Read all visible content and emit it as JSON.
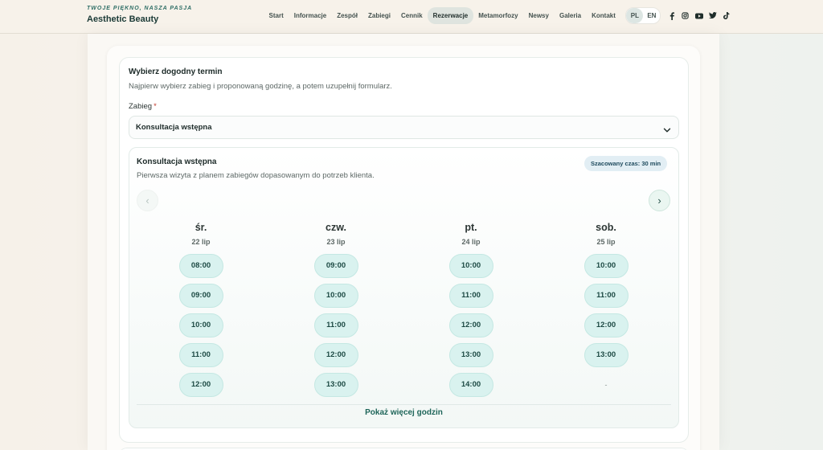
{
  "header": {
    "tagline": "TWOJE PIĘKNO, NASZA PASJA",
    "brand": "Aesthetic Beauty",
    "nav": [
      {
        "label": "Start",
        "active": false
      },
      {
        "label": "Informacje",
        "active": false
      },
      {
        "label": "Zespół",
        "active": false
      },
      {
        "label": "Zabiegi",
        "active": false
      },
      {
        "label": "Cennik",
        "active": false
      },
      {
        "label": "Rezerwacje",
        "active": true
      },
      {
        "label": "Metamorfozy",
        "active": false
      },
      {
        "label": "Newsy",
        "active": false
      },
      {
        "label": "Galeria",
        "active": false
      },
      {
        "label": "Kontakt",
        "active": false
      }
    ],
    "languages": [
      {
        "label": "PL",
        "active": true
      },
      {
        "label": "EN",
        "active": false
      }
    ],
    "social_icons": [
      "facebook-icon",
      "instagram-icon",
      "youtube-icon",
      "twitter-icon",
      "tiktok-icon"
    ]
  },
  "booking": {
    "title": "Wybierz dogodny termin",
    "subtitle": "Najpierw wybierz zabieg i proponowaną godzinę, a potem uzupełnij formularz.",
    "service_label": "Zabieg",
    "required_mark": "*",
    "selected_service": "Konsultacja wstępna",
    "service_name": "Konsultacja wstępna",
    "service_description": "Pierwsza wizyta z planem zabiegów dopasowanym do potrzeb klienta.",
    "duration_badge": "Szacowany czas: 30 min",
    "prev_label": "‹",
    "next_label": "›",
    "days": [
      {
        "name": "śr.",
        "date": "22 lip",
        "slots": [
          "08:00",
          "09:00",
          "10:00",
          "11:00",
          "12:00"
        ]
      },
      {
        "name": "czw.",
        "date": "23 lip",
        "slots": [
          "09:00",
          "10:00",
          "11:00",
          "12:00",
          "13:00"
        ]
      },
      {
        "name": "pt.",
        "date": "24 lip",
        "slots": [
          "10:00",
          "11:00",
          "12:00",
          "13:00",
          "14:00"
        ]
      },
      {
        "name": "sob.",
        "date": "25 lip",
        "slots": [
          "10:00",
          "11:00",
          "12:00",
          "13:00"
        ],
        "empty_marker": "-"
      }
    ],
    "show_more": "Pokaż więcej godzin"
  },
  "colors": {
    "accent": "#1f6559",
    "slot_bg": "#d9f2ef",
    "header_bg": "#f7f2ea"
  }
}
